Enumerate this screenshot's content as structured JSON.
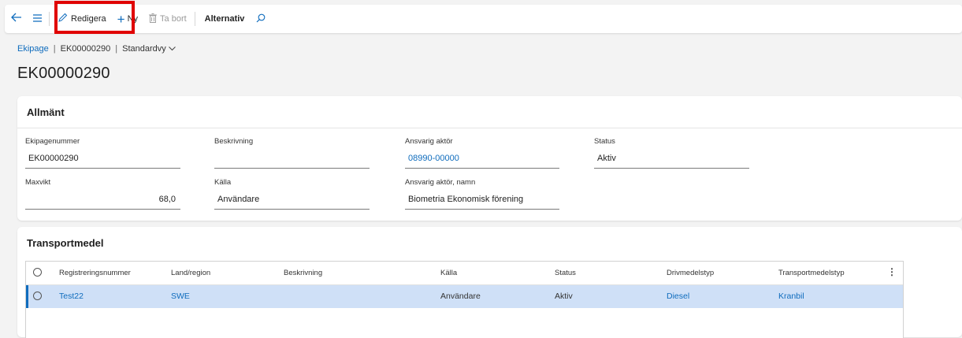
{
  "toolbar": {
    "edit_label": "Redigera",
    "new_label": "Ny",
    "delete_label": "Ta bort",
    "options_label": "Alternativ"
  },
  "breadcrumb": {
    "root": "Ekipage",
    "record": "EK00000290",
    "view": "Standardvy"
  },
  "page_title": "EK00000290",
  "general": {
    "header": "Allmänt",
    "fields": {
      "ekipagenummer": {
        "label": "Ekipagenummer",
        "value": "EK00000290"
      },
      "beskrivning": {
        "label": "Beskrivning",
        "value": ""
      },
      "ansvarig_aktor": {
        "label": "Ansvarig aktör",
        "value": "08990-00000"
      },
      "status": {
        "label": "Status",
        "value": "Aktiv"
      },
      "maxvikt": {
        "label": "Maxvikt",
        "value": "68,0"
      },
      "kalla": {
        "label": "Källa",
        "value": "Användare"
      },
      "ansvarig_aktor_namn": {
        "label": "Ansvarig aktör, namn",
        "value": "Biometria Ekonomisk förening"
      }
    }
  },
  "transport": {
    "header": "Transportmedel",
    "columns": [
      "Registreringsnummer",
      "Land/region",
      "Beskrivning",
      "Källa",
      "Status",
      "Drivmedelstyp",
      "Transportmedelstyp"
    ],
    "rows": [
      {
        "registreringsnummer": "Test22",
        "land": "SWE",
        "beskrivning": "",
        "kalla": "Användare",
        "status": "Aktiv",
        "drivmedelstyp": "Diesel",
        "transportmedelstyp": "Kranbil"
      }
    ]
  },
  "colors": {
    "accent": "#0f6cbd",
    "highlight": "#e00000",
    "selected_row": "#cfe0f7"
  }
}
